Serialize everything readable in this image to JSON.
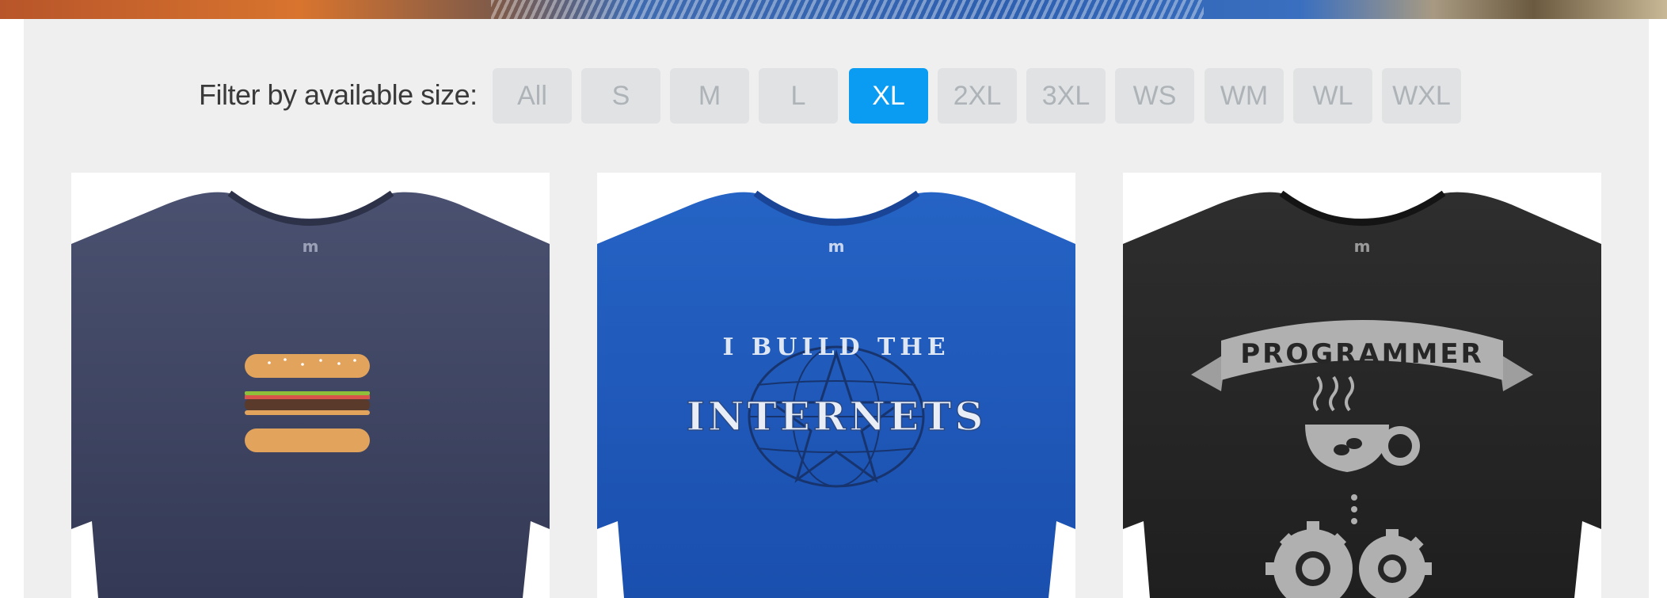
{
  "filter": {
    "label": "Filter by available size:",
    "sizes": [
      "All",
      "S",
      "M",
      "L",
      "XL",
      "2XL",
      "3XL",
      "WS",
      "WM",
      "WL",
      "WXL"
    ],
    "selected": "XL"
  },
  "products": [
    {
      "shirt_color": "#3d4463",
      "design": "hamburger-icon"
    },
    {
      "shirt_color": "#1e56b8",
      "design_text_top": "I BUILD THE",
      "design_text_main": "INTERNETS"
    },
    {
      "shirt_color": "#262626",
      "design_text_banner": "PROGRAMMER",
      "design": "coffee-cup-gears"
    }
  ],
  "colors": {
    "accent": "#0a9cf2",
    "button_bg": "#e0e2e4",
    "panel_bg": "#efefef"
  }
}
